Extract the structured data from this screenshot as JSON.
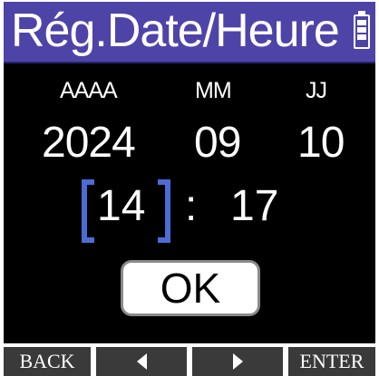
{
  "header": {
    "title": "Rég.Date/Heure"
  },
  "date": {
    "year_label": "AAAA",
    "month_label": "MM",
    "day_label": "JJ",
    "year": "2024",
    "month": "09",
    "day": "10"
  },
  "time": {
    "hour": "14",
    "separator": ":",
    "minute": "17"
  },
  "ok_label": "OK",
  "softkeys": {
    "back": "BACK",
    "enter": "ENTER"
  },
  "colors": {
    "title_bar": "#4e44a8",
    "selection_bracket": "#4c6bd4",
    "screen_background": "#000000",
    "softkey_background": "#3a3a3a"
  },
  "icons": {
    "battery": "battery-icon",
    "left": "left-arrow-icon",
    "right": "right-arrow-icon"
  },
  "state": {
    "selected_field": "hour"
  }
}
